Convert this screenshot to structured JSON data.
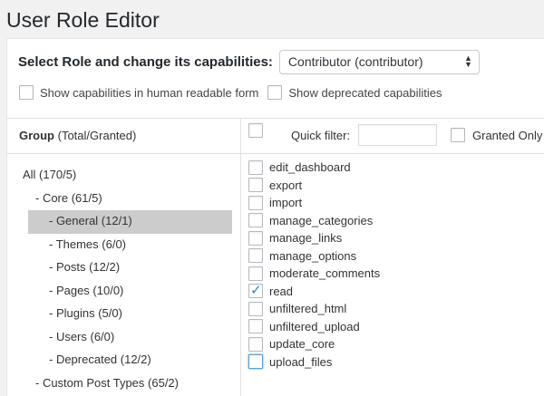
{
  "page": {
    "title": "User Role Editor"
  },
  "role": {
    "label": "Select Role and change its capabilities:",
    "selected": "Contributor (contributor)"
  },
  "options": [
    {
      "label": "Show capabilities in human readable form",
      "checked": false
    },
    {
      "label": "Show deprecated capabilities",
      "checked": false
    }
  ],
  "groups_header": {
    "title": "Group",
    "suffix": "(Total/Granted)"
  },
  "filter": {
    "label": "Quick filter:",
    "value": "",
    "granted_only_label": "Granted Only"
  },
  "tree": [
    {
      "label": "All (170/5)",
      "level": 0,
      "selected": false
    },
    {
      "label": "- Core (61/5)",
      "level": 1,
      "selected": false
    },
    {
      "label": "- General (12/1)",
      "level": 2,
      "selected": true
    },
    {
      "label": "- Themes (6/0)",
      "level": 2,
      "selected": false
    },
    {
      "label": "- Posts (12/2)",
      "level": 2,
      "selected": false
    },
    {
      "label": "- Pages (10/0)",
      "level": 2,
      "selected": false
    },
    {
      "label": "- Plugins (5/0)",
      "level": 2,
      "selected": false
    },
    {
      "label": "- Users (6/0)",
      "level": 2,
      "selected": false
    },
    {
      "label": "- Deprecated (12/2)",
      "level": 2,
      "selected": false
    },
    {
      "label": "- Custom Post Types (65/2)",
      "level": 1,
      "selected": false
    }
  ],
  "capabilities": [
    {
      "name": "edit_dashboard",
      "checked": false
    },
    {
      "name": "export",
      "checked": false
    },
    {
      "name": "import",
      "checked": false
    },
    {
      "name": "manage_categories",
      "checked": false
    },
    {
      "name": "manage_links",
      "checked": false
    },
    {
      "name": "manage_options",
      "checked": false
    },
    {
      "name": "moderate_comments",
      "checked": false
    },
    {
      "name": "read",
      "checked": true
    },
    {
      "name": "unfiltered_html",
      "checked": false
    },
    {
      "name": "unfiltered_upload",
      "checked": false
    },
    {
      "name": "update_core",
      "checked": false
    },
    {
      "name": "upload_files",
      "checked": false,
      "focused": true
    }
  ],
  "icons": {
    "check": "checkmark-icon",
    "select_arrows": "updown-arrows-icon"
  },
  "colors": {
    "accent": "#1e8cbe",
    "selected_bg": "#cccccc",
    "page_bg": "#f1f1f1"
  }
}
